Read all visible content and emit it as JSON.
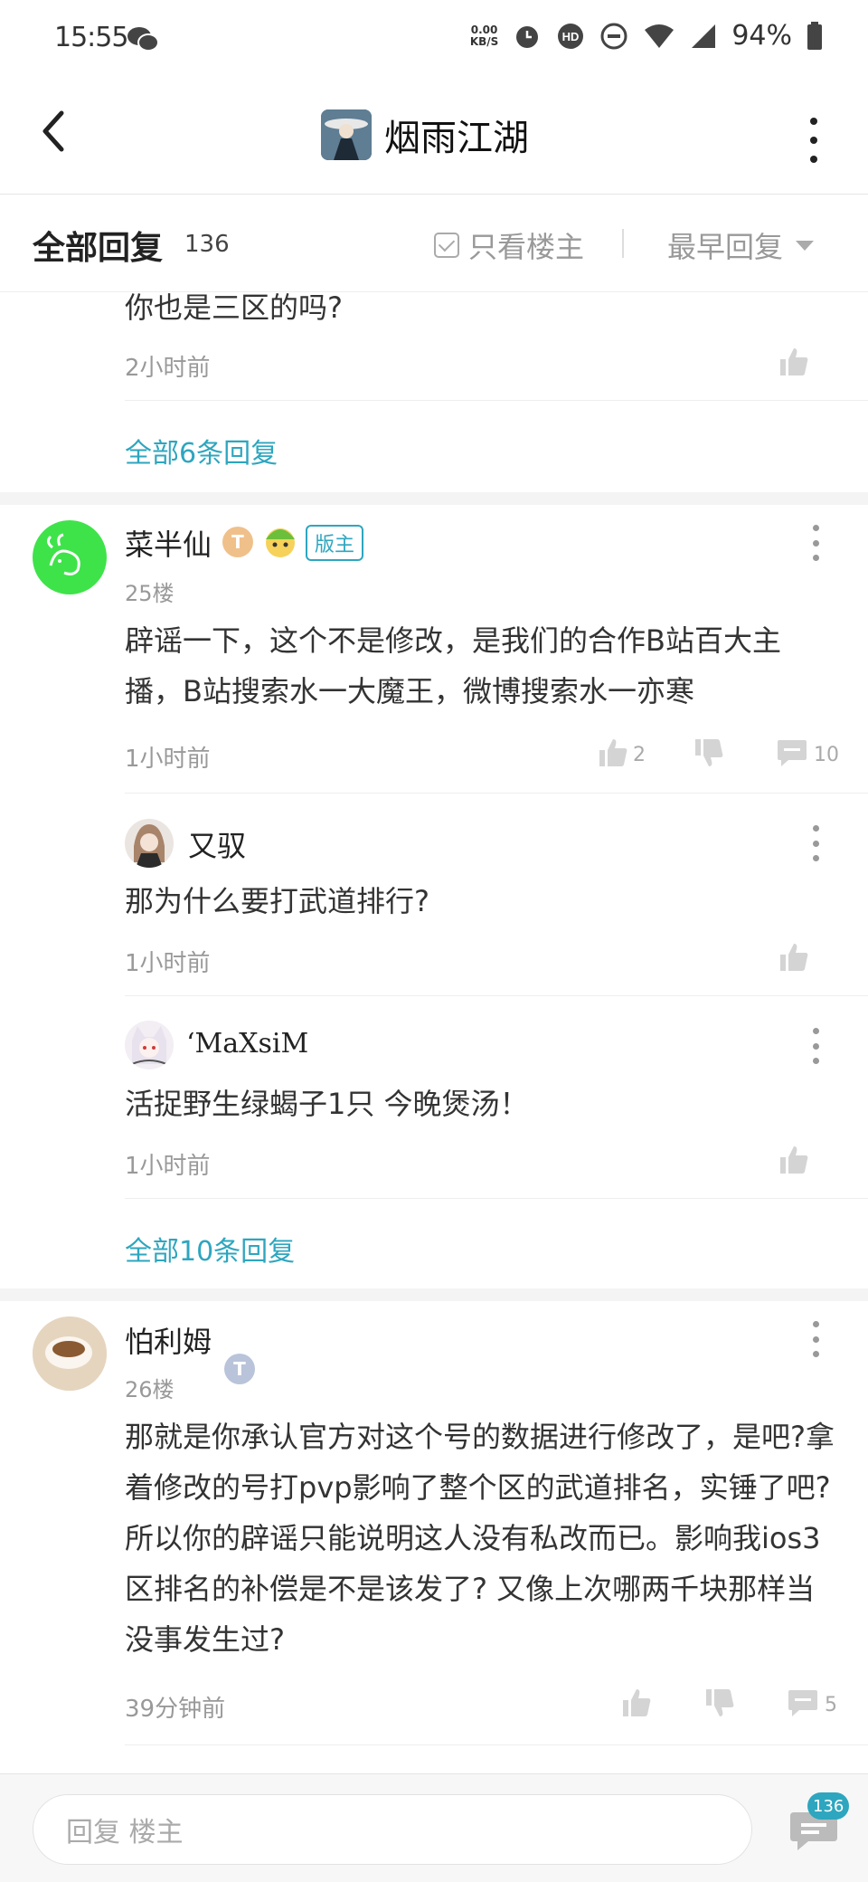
{
  "status_bar": {
    "time": "15:55",
    "net_speed_top": "0.00",
    "net_speed_bottom": "KB/S",
    "battery": "94%"
  },
  "header": {
    "title": "烟雨江湖"
  },
  "filter_bar": {
    "all_replies_label": "全部回复",
    "reply_count": "136",
    "only_op_label": "只看楼主",
    "sort_label": "最早回复"
  },
  "prev_thread": {
    "reply_text": "你也是三区的吗?",
    "reply_time": "2小时前",
    "view_all": "全部6条回复"
  },
  "post25": {
    "author": "菜半仙",
    "level_badge": "T",
    "mod_label": "版主",
    "floor": "25楼",
    "content": "辟谣一下，这个不是修改，是我们的合作B站百大主播，B站搜索水一大魔王，微博搜索水一亦寒",
    "time": "1小时前",
    "likes": "2",
    "comments": "10",
    "replies": [
      {
        "author": "又驭",
        "content": "那为什么要打武道排行?",
        "time": "1小时前"
      },
      {
        "author": "‘MaXsiM",
        "content": "活捉野生绿蝎子1只  今晚煲汤！",
        "time": "1小时前"
      }
    ],
    "view_all": "全部10条回复"
  },
  "post26": {
    "author": "怕利姆",
    "level_badge": "T",
    "floor": "26楼",
    "content": "那就是你承认官方对这个号的数据进行修改了，是吧?拿着修改的号打pvp影响了整个区的武道排名，实锤了吧? 所以你的辟谣只能说明这人没有私改而已。影响我ios3区排名的补偿是不是该发了? 又像上次哪两千块那样当没事发生过?",
    "time": "39分钟前",
    "comments": "5"
  },
  "bottom_bar": {
    "placeholder": "回复  楼主",
    "total_count": "136"
  }
}
